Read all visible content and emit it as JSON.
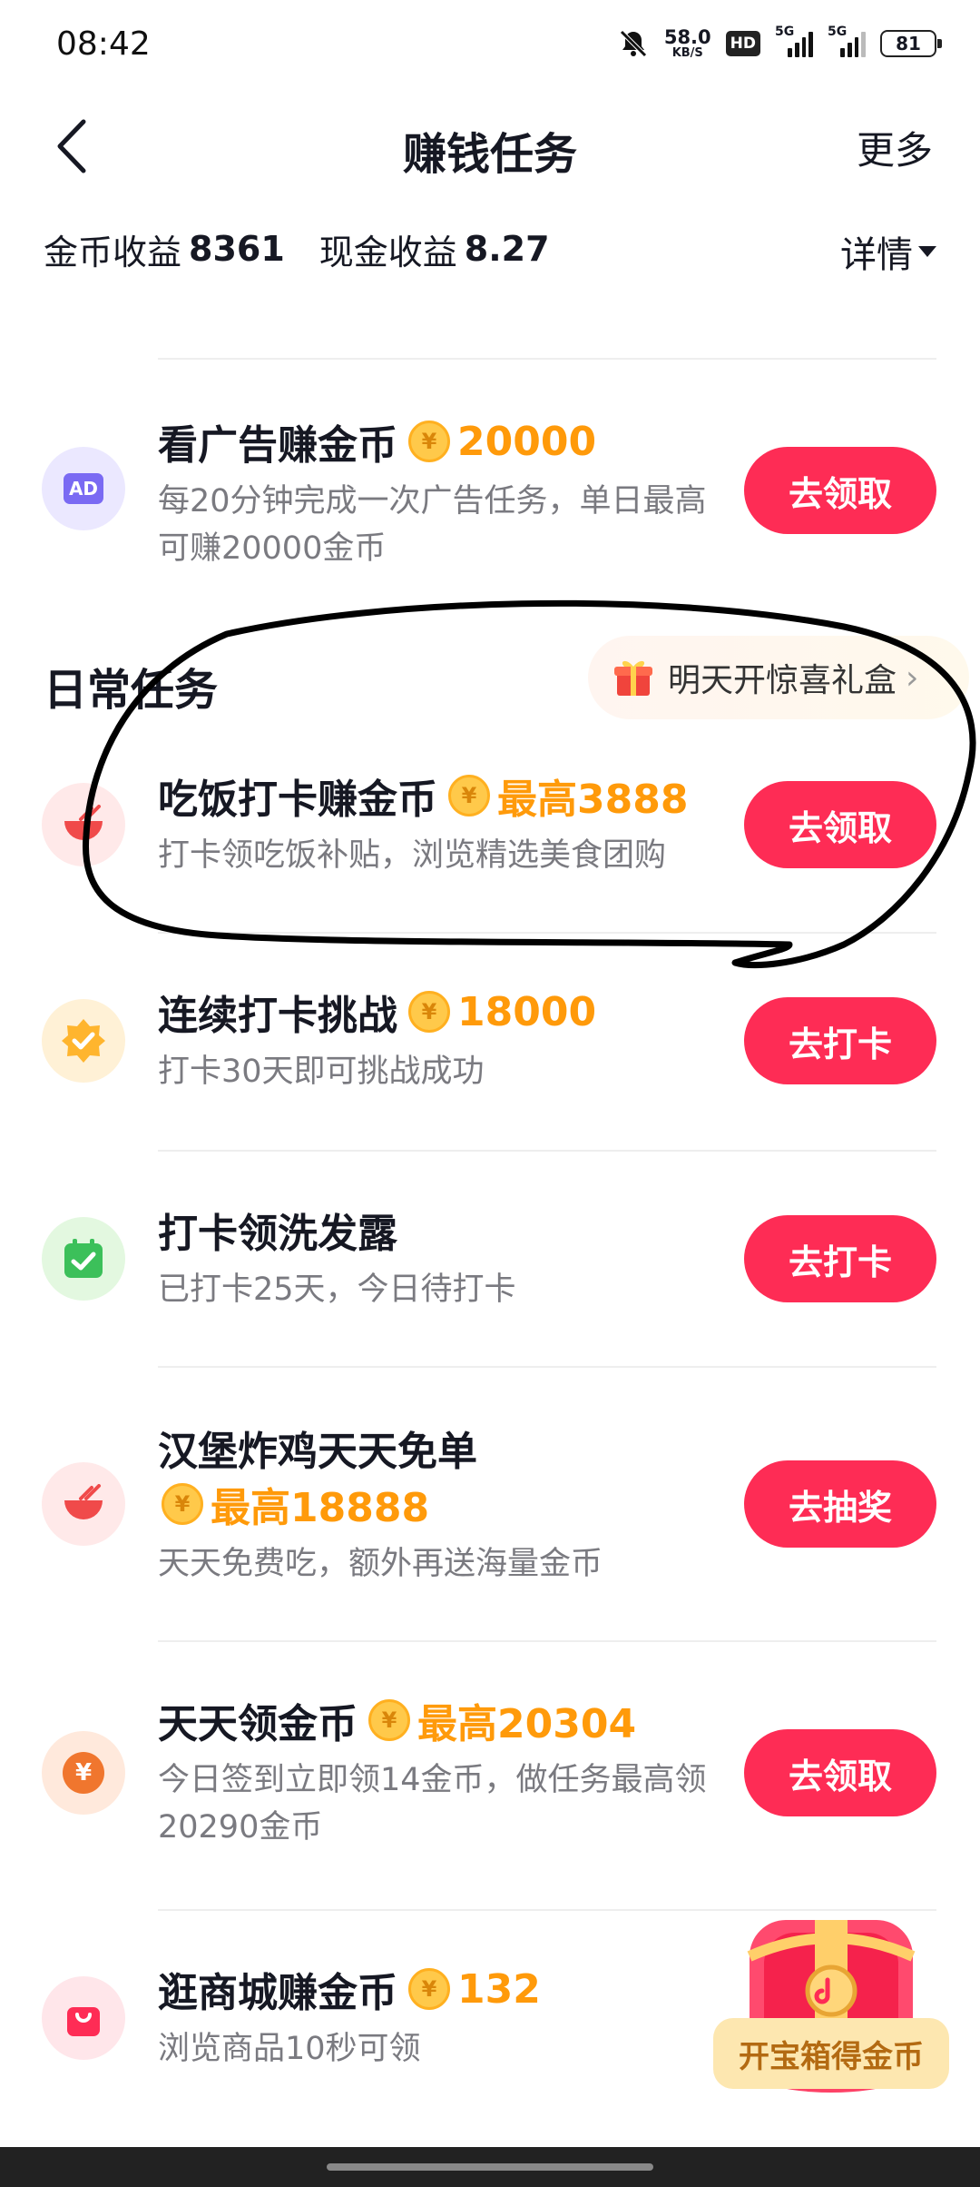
{
  "status": {
    "time": "08:42",
    "speed_value": "58.0",
    "speed_unit": "KB/S",
    "hd": "HD",
    "net1": "5G",
    "net2": "5G",
    "battery": "81"
  },
  "nav": {
    "title": "赚钱任务",
    "more": "更多"
  },
  "earnings": {
    "coin_label": "金币收益",
    "coin_value": "8361",
    "cash_label": "现金收益",
    "cash_value": "8.27",
    "detail": "详情"
  },
  "tasks_top": [
    {
      "title": "看广告赚金币",
      "coin": "¥",
      "reward": "20000",
      "desc": "每20分钟完成一次广告任务，单日最高可赚20000金币",
      "button": "去领取",
      "icon": "ad-icon",
      "icon_text": "AD"
    }
  ],
  "section": {
    "title": "日常任务",
    "gift_text": "明天开惊喜礼盒",
    "gift_chevron": "›"
  },
  "tasks": [
    {
      "title": "吃饭打卡赚金币",
      "coin": "¥",
      "reward": "最高3888",
      "desc": "打卡领吃饭补贴，浏览精选美食团购",
      "button": "去领取",
      "icon": "bowl-icon"
    },
    {
      "title": "连续打卡挑战",
      "coin": "¥",
      "reward": "18000",
      "desc": "打卡30天即可挑战成功",
      "button": "去打卡",
      "icon": "badge-check-icon"
    },
    {
      "title": "打卡领洗发露",
      "coin": "",
      "reward": "",
      "desc": "已打卡25天，今日待打卡",
      "button": "去打卡",
      "icon": "calendar-check-icon"
    },
    {
      "title": "汉堡炸鸡天天免单",
      "coin": "¥",
      "reward": "最高18888",
      "desc": "天天免费吃，额外再送海量金币",
      "button": "去抽奖",
      "icon": "bowl-icon"
    },
    {
      "title": "天天领金币",
      "coin": "¥",
      "reward": "最高20304",
      "desc": "今日签到立即领14金币，做任务最高领20290金币",
      "button": "去领取",
      "icon": "yen-coin-icon"
    },
    {
      "title": "逛商城赚金币",
      "coin": "¥",
      "reward": "132",
      "desc": "浏览商品10秒可领",
      "button": "",
      "icon": "shopping-bag-icon"
    }
  ],
  "chest": {
    "label": "开宝箱得金币",
    "icon": "treasure-chest-icon"
  }
}
